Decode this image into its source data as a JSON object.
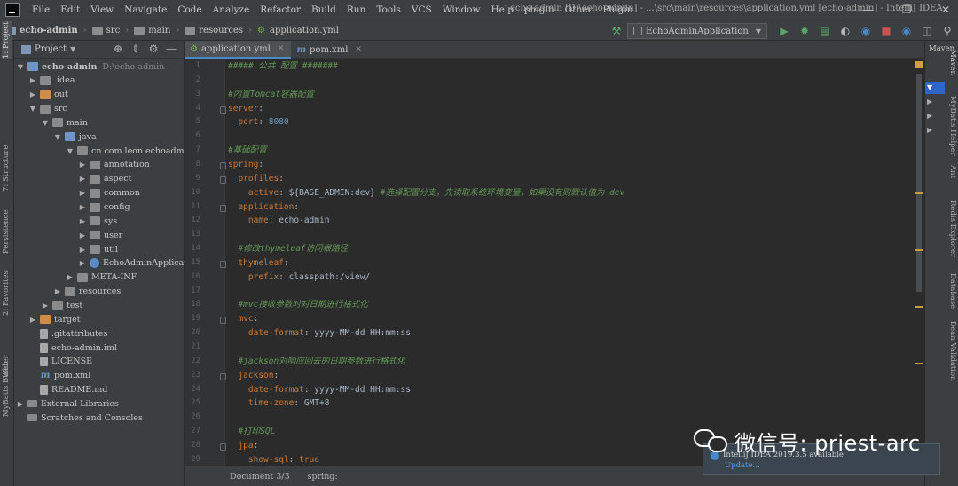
{
  "menu": [
    "File",
    "Edit",
    "View",
    "Navigate",
    "Code",
    "Analyze",
    "Refactor",
    "Build",
    "Run",
    "Tools",
    "VCS",
    "Window",
    "Help",
    "plugin",
    "Other",
    "Plugin"
  ],
  "window_title": "echo-admin [D:\\echo-admin] - ...\\src\\main\\resources\\application.yml [echo-admin] - IntelliJ IDEA",
  "breadcrumbs": [
    "echo-admin",
    "src",
    "main",
    "resources",
    "application.yml"
  ],
  "run_config": "EchoAdminApplication",
  "project_panel": {
    "title": "Project",
    "tree": [
      {
        "label": "echo-admin",
        "path": "D:\\echo-admin",
        "icon": "folder-blue",
        "depth": 0,
        "toggle": "open"
      },
      {
        "label": ".idea",
        "icon": "folder",
        "depth": 1,
        "toggle": "closed"
      },
      {
        "label": "out",
        "icon": "folder-orange",
        "depth": 1,
        "toggle": "closed"
      },
      {
        "label": "src",
        "icon": "folder",
        "depth": 1,
        "toggle": "open"
      },
      {
        "label": "main",
        "icon": "folder",
        "depth": 2,
        "toggle": "open"
      },
      {
        "label": "java",
        "icon": "folder-blue",
        "depth": 3,
        "toggle": "open"
      },
      {
        "label": "cn.com.leon.echoadmin",
        "icon": "pkg",
        "depth": 4,
        "toggle": "open"
      },
      {
        "label": "annotation",
        "icon": "pkg",
        "depth": 5,
        "toggle": "closed"
      },
      {
        "label": "aspect",
        "icon": "pkg",
        "depth": 5,
        "toggle": "closed"
      },
      {
        "label": "common",
        "icon": "pkg",
        "depth": 5,
        "toggle": "closed"
      },
      {
        "label": "config",
        "icon": "pkg",
        "depth": 5,
        "toggle": "closed"
      },
      {
        "label": "sys",
        "icon": "pkg",
        "depth": 5,
        "toggle": "closed"
      },
      {
        "label": "user",
        "icon": "pkg",
        "depth": 5,
        "toggle": "closed"
      },
      {
        "label": "util",
        "icon": "pkg",
        "depth": 5,
        "toggle": "closed"
      },
      {
        "label": "EchoAdminApplication",
        "icon": "class",
        "depth": 5,
        "toggle": "closed"
      },
      {
        "label": "META-INF",
        "icon": "folder",
        "depth": 4,
        "toggle": "closed"
      },
      {
        "label": "resources",
        "icon": "folder",
        "depth": 3,
        "toggle": "closed"
      },
      {
        "label": "test",
        "icon": "folder",
        "depth": 2,
        "toggle": "closed"
      },
      {
        "label": "target",
        "icon": "folder-orange",
        "depth": 1,
        "toggle": "closed"
      },
      {
        "label": ".gitattributes",
        "icon": "file",
        "depth": 1,
        "toggle": "none"
      },
      {
        "label": "echo-admin.iml",
        "icon": "file",
        "depth": 1,
        "toggle": "none"
      },
      {
        "label": "LICENSE",
        "icon": "file",
        "depth": 1,
        "toggle": "none"
      },
      {
        "label": "pom.xml",
        "icon": "mvn",
        "depth": 1,
        "toggle": "none"
      },
      {
        "label": "README.md",
        "icon": "file",
        "depth": 1,
        "toggle": "none"
      },
      {
        "label": "External Libraries",
        "icon": "libs",
        "depth": 0,
        "toggle": "closed"
      },
      {
        "label": "Scratches and Consoles",
        "icon": "libs",
        "depth": 0,
        "toggle": "none"
      }
    ]
  },
  "left_stripe": [
    "1: Project",
    "7: Structure",
    "Persistence",
    "2: Favorites",
    "Web",
    "MyBatis Builder"
  ],
  "right_stripe": [
    "Maven",
    "MyBatis Helper",
    "Ant",
    "Redis Explorer",
    "Database",
    "Bean Validation"
  ],
  "editor_tabs": [
    {
      "label": "application.yml",
      "icon": "yml-icon",
      "active": true
    },
    {
      "label": "pom.xml",
      "icon": "maven-icon",
      "active": false
    }
  ],
  "code_lines": [
    [
      [
        "c-com",
        "##### 公共 配置 #######"
      ]
    ],
    [],
    [
      [
        "c-com",
        "#内置Tomcat容器配置"
      ]
    ],
    [
      [
        "c-key",
        "server"
      ],
      [
        "c-punc",
        ":"
      ]
    ],
    [
      [
        "c-punc",
        "  "
      ],
      [
        "c-key",
        "port"
      ],
      [
        "c-punc",
        ": "
      ],
      [
        "c-num",
        "8080"
      ]
    ],
    [],
    [
      [
        "c-com",
        "#基础配置"
      ]
    ],
    [
      [
        "c-key",
        "spring"
      ],
      [
        "c-punc",
        ":"
      ]
    ],
    [
      [
        "c-punc",
        "  "
      ],
      [
        "c-key",
        "profiles"
      ],
      [
        "c-punc",
        ":"
      ]
    ],
    [
      [
        "c-punc",
        "    "
      ],
      [
        "c-key",
        "active"
      ],
      [
        "c-punc",
        ": "
      ],
      [
        "c-val",
        "${BASE_ADMIN:dev}"
      ],
      [
        "c-com",
        " #选择配置分支，先读取系统环境变量，如果没有则默认值为 dev"
      ]
    ],
    [
      [
        "c-punc",
        "  "
      ],
      [
        "c-key",
        "application"
      ],
      [
        "c-punc",
        ":"
      ]
    ],
    [
      [
        "c-punc",
        "    "
      ],
      [
        "c-key",
        "name"
      ],
      [
        "c-punc",
        ": "
      ],
      [
        "c-val",
        "echo-admin"
      ]
    ],
    [],
    [
      [
        "c-punc",
        "  "
      ],
      [
        "c-com",
        "#修改thymeleaf访问根路径"
      ]
    ],
    [
      [
        "c-punc",
        "  "
      ],
      [
        "c-key",
        "thymeleaf"
      ],
      [
        "c-punc",
        ":"
      ]
    ],
    [
      [
        "c-punc",
        "    "
      ],
      [
        "c-key",
        "prefix"
      ],
      [
        "c-punc",
        ": "
      ],
      [
        "c-val",
        "classpath:/view/"
      ]
    ],
    [],
    [
      [
        "c-punc",
        "  "
      ],
      [
        "c-com",
        "#mvc接收参数时对日期进行格式化"
      ]
    ],
    [
      [
        "c-punc",
        "  "
      ],
      [
        "c-key",
        "mvc"
      ],
      [
        "c-punc",
        ":"
      ]
    ],
    [
      [
        "c-punc",
        "    "
      ],
      [
        "c-key",
        "date-format"
      ],
      [
        "c-punc",
        ": "
      ],
      [
        "c-val",
        "yyyy-MM-dd HH:mm:ss"
      ]
    ],
    [],
    [
      [
        "c-punc",
        "  "
      ],
      [
        "c-com",
        "#jackson对响应回去的日期参数进行格式化"
      ]
    ],
    [
      [
        "c-punc",
        "  "
      ],
      [
        "c-key",
        "jackson"
      ],
      [
        "c-punc",
        ":"
      ]
    ],
    [
      [
        "c-punc",
        "    "
      ],
      [
        "c-key",
        "date-format"
      ],
      [
        "c-punc",
        ": "
      ],
      [
        "c-val",
        "yyyy-MM-dd HH:mm:ss"
      ]
    ],
    [
      [
        "c-punc",
        "    "
      ],
      [
        "c-key",
        "time-zone"
      ],
      [
        "c-punc",
        ": "
      ],
      [
        "c-val",
        "GMT+8"
      ]
    ],
    [],
    [
      [
        "c-punc",
        "  "
      ],
      [
        "c-com",
        "#打印SQL"
      ]
    ],
    [
      [
        "c-punc",
        "  "
      ],
      [
        "c-key",
        "jpa"
      ],
      [
        "c-punc",
        ":"
      ]
    ],
    [
      [
        "c-punc",
        "    "
      ],
      [
        "c-key",
        "show-sql"
      ],
      [
        "c-punc",
        ": "
      ],
      [
        "c-key",
        "true"
      ]
    ]
  ],
  "status_bar": {
    "document": "Document 3/3",
    "path": "spring:"
  },
  "notification": {
    "title": "IntelliJ IDEA 2019.3.5 available",
    "link": "Update..."
  },
  "watermark": {
    "text": "微信号: priest-arc"
  },
  "colors": {
    "accent": "#4a88c7",
    "comment": "#629755",
    "keyword": "#cc7832",
    "number": "#6897bb"
  }
}
